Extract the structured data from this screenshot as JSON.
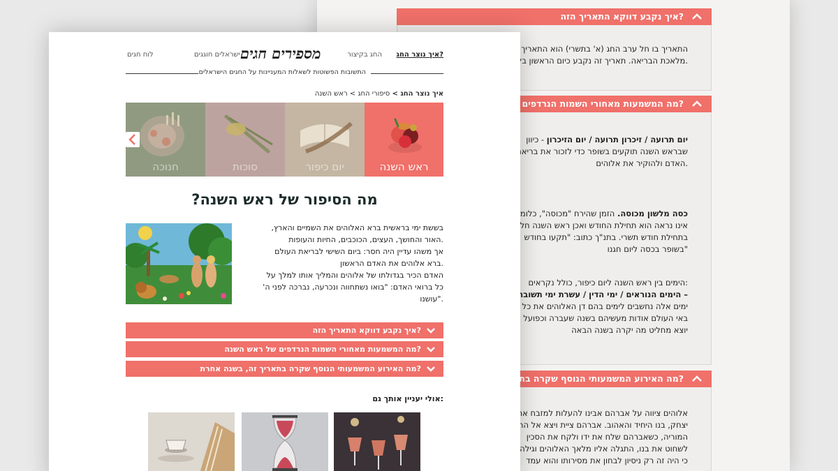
{
  "back": {
    "acc1_title": "?איך נקבע דווקא התאריך הזה",
    "acc1_lines": [
      "התאריך בו חל ערב החג (א' בתשרי) הוא התאריך בו ברא",
      ".מלאכת הבריאה. תאריך זה נקבע כיום הראשון בלוח הש"
    ],
    "acc2_title": "?מה המשמעות מאחורי השמות הנרדפים של ראש השנה",
    "acc2_p1_bold": "יום תרועה / זיכרון תרועה / יום הזיכרון",
    "acc2_p1_rest": " - כיוון",
    "acc2_p1_lines": [
      "שבראש השנה תוקעים בשופר כדי לזכור את בריאת",
      ".האדם ולהוקיר את אלוהים"
    ],
    "acc2_p2_bold": "כסה מלשון מכוסה.",
    "acc2_p2_rest": " הזמן שהירח \"מכוסה\", כלומר",
    "acc2_p2_lines": [
      "אינו נראה הוא תחילת החודש ואכן ראש השנה חל",
      "בתחילת חודש תשרי.  בתנ\"ך כתוב: \"תקעו בחודש",
      "\"בשופר בכסה ליום חגנו"
    ],
    "acc2_p3_first": ":הימים בין ראש השנה ליום כיפור, כולל נקראים",
    "acc2_p3_bold": "– הימים הנוראים / ימי הדין / עשרת ימי תשובה",
    "acc2_p3_lines": [
      "ימים אלה נחשבים לימים בהם דן האלוהים את כל",
      "באי העולם אודות מעשיהם בשנה שעברה וכפועל",
      "יוצא מחליט מה יקרה בשנה הבאה"
    ],
    "acc3_title": "?מה האירוע המשמעותי הנוסף שקרה בתאריך זה, בשנה אחרת",
    "acc3_lines": [
      "אלוהים ציווה על אברהם אבינו להעלות למזבח את",
      "יצחק, בנו היחיד והאהוב. אברהם ציית ויצא אל הר",
      "המוריה, כשאברהם שלח את ידו ולקח את הסכין",
      "לשחוט את בנו, התגלה אליו מלאך האלוהים וגילה לו",
      "כי היה זה רק ניסיון לבחון את מסירותו והוא עמד"
    ]
  },
  "nav": {
    "item1": "איך נוצר החג?",
    "item2": "החג בקיצור",
    "item3": "ישראלים חוגגים",
    "item4": "לוח חגים"
  },
  "logo": "מספירים חגים",
  "tagline": "התשובות הפשוטות לשאלות המעניינות על החגים הישראלים",
  "breadcrumb": {
    "bold": "איך נוצר החג >",
    "rest": " סיפורי החג > ראש השנה"
  },
  "carousel": {
    "slides": [
      "ראש השנה",
      "יום כיפור",
      "סוכות",
      "חנוכה"
    ]
  },
  "title": "מה הסיפור של ראש השנה?",
  "story": [
    "בששת ימי בראשית ברא האלוהים את השמיים והארץ,",
    ".האור והחושך, העצים, הכוכבים, החיות והעופות",
    "אך משהו עדיין היה חסר: ביום השישי לבריאת העולם",
    ".ברא אלוהים את האדם הראשון",
    "האדם הכיר בגדולתו של אלוהים והמליך אותו למלך על",
    "כל ברואי האדם: \"בואו נשתחווה ונכרעה, נברכה לפני ה'",
    ".\"עושנו"
  ],
  "accordion": [
    "?איך נקבע דווקא התאריך הזה",
    "?מה המשמעות מאחורי השמות הנרדפים של ראש השנה",
    "?מה האירוע המשמעותי הנוסף שקרה בתאריך זה, בשנה אחרת"
  ],
  "related_label": ":אולי יעניין אותך גם",
  "colors": {
    "accent": "#f0706a",
    "page_bg": "#e9e9e9"
  }
}
